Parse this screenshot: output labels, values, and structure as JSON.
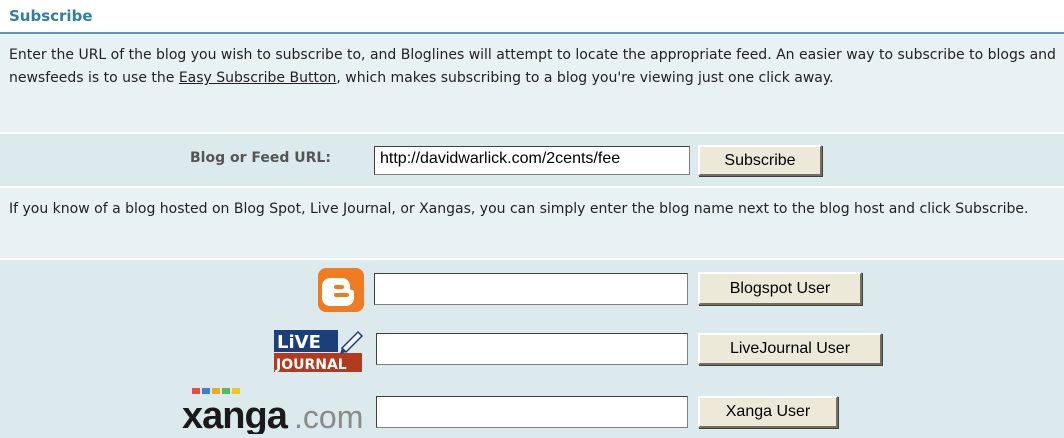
{
  "section": {
    "title": "Subscribe"
  },
  "intro": {
    "text_before": "Enter the URL of the blog you wish to subscribe to, and Bloglines will attempt to locate the appropriate feed. An easier way to subscribe to blogs and newsfeeds is to use the ",
    "link": "Easy Subscribe Button",
    "text_after": ", which makes subscribing to a blog you're viewing just one click away."
  },
  "feed": {
    "label": "Blog or Feed URL:",
    "value": "http://davidwarlick.com/2cents/fee",
    "button": "Subscribe"
  },
  "hosts_intro": "If you know of a blog hosted on Blog Spot, Live Journal, or Xangas, you can simply enter the blog name next to the blog host and click Subscribe.",
  "hosts": {
    "blogspot": {
      "button": "Blogspot User",
      "icon": "blogger-logo-icon"
    },
    "livejournal": {
      "button": "LiveJournal User",
      "logo_line1": "LiVE",
      "logo_line2": "JOURNAL"
    },
    "xanga": {
      "button": "Xanga User",
      "logo_brand": "xanga",
      "logo_tld": ".com"
    }
  },
  "colors": {
    "title": "#2f7f9f",
    "band": "#e8f1f4",
    "blogger_orange": "#f07c22"
  }
}
